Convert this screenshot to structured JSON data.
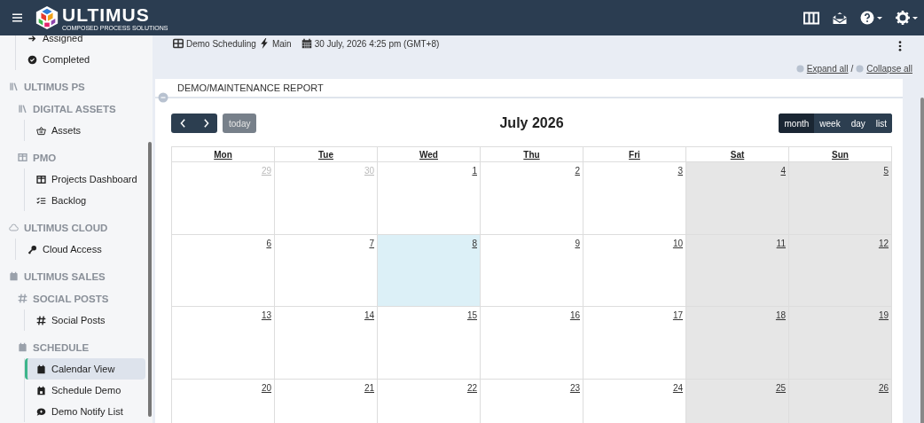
{
  "header": {
    "logo_name": "ULTIMUS",
    "logo_tagline": "COMPOSED PROCESS SOLUTIONS"
  },
  "sidebar": {
    "items": [
      {
        "kind": "link",
        "label": "Assigned",
        "selected": false
      },
      {
        "kind": "link",
        "label": "Completed",
        "selected": false
      },
      {
        "kind": "section",
        "label": "ULTIMUS PS",
        "children": [
          {
            "kind": "subsection",
            "label": "DIGITAL ASSETS",
            "children": [
              {
                "kind": "link",
                "label": "Assets",
                "selected": false
              }
            ]
          },
          {
            "kind": "subsection",
            "label": "PMO",
            "children": [
              {
                "kind": "link",
                "label": "Projects Dashboard",
                "selected": false
              },
              {
                "kind": "link",
                "label": "Backlog",
                "selected": false
              }
            ]
          }
        ]
      },
      {
        "kind": "section",
        "label": "ULTIMUS CLOUD",
        "children": [
          {
            "kind": "link",
            "label": "Cloud Access",
            "selected": false
          }
        ]
      },
      {
        "kind": "section",
        "label": "ULTIMUS SALES",
        "children": [
          {
            "kind": "subsection",
            "label": "SOCIAL POSTS",
            "children": [
              {
                "kind": "link",
                "label": "Social Posts",
                "selected": false
              }
            ]
          },
          {
            "kind": "subsection",
            "label": "SCHEDULE",
            "children": [
              {
                "kind": "link",
                "label": "Calendar View",
                "selected": true
              },
              {
                "kind": "link",
                "label": "Schedule Demo",
                "selected": false
              },
              {
                "kind": "link",
                "label": "Demo Notify List",
                "selected": false
              }
            ]
          }
        ]
      }
    ]
  },
  "breadcrumb": {
    "app": "Demo Scheduling",
    "branch": "Main",
    "datetime": "30 July, 2026 4:25 pm (GMT+8)"
  },
  "expand_all": "Expand all",
  "separator": "/",
  "collapse_all": "Collapse all",
  "card": {
    "title": "DEMO/MAINTENANCE REPORT"
  },
  "calendar": {
    "today_button": {
      "label": "today",
      "disabled": true
    },
    "title": "July 2026",
    "views": [
      {
        "label": "month",
        "selected": true
      },
      {
        "label": "week",
        "selected": false
      },
      {
        "label": "day",
        "selected": false
      },
      {
        "label": "list",
        "selected": false
      }
    ],
    "columns": [
      "Mon",
      "Tue",
      "Wed",
      "Thu",
      "Fri",
      "Sat",
      "Sun"
    ],
    "weeks": [
      [
        {
          "day": "29",
          "other_month": true,
          "today": false,
          "weekend": false
        },
        {
          "day": "30",
          "other_month": true,
          "today": false,
          "weekend": false
        },
        {
          "day": "1",
          "other_month": false,
          "today": false,
          "weekend": false
        },
        {
          "day": "2",
          "other_month": false,
          "today": false,
          "weekend": false
        },
        {
          "day": "3",
          "other_month": false,
          "today": false,
          "weekend": false
        },
        {
          "day": "4",
          "other_month": false,
          "today": false,
          "weekend": true
        },
        {
          "day": "5",
          "other_month": false,
          "today": false,
          "weekend": true
        }
      ],
      [
        {
          "day": "6",
          "other_month": false,
          "today": false,
          "weekend": false
        },
        {
          "day": "7",
          "other_month": false,
          "today": false,
          "weekend": false
        },
        {
          "day": "8",
          "other_month": false,
          "today": true,
          "weekend": false
        },
        {
          "day": "9",
          "other_month": false,
          "today": false,
          "weekend": false
        },
        {
          "day": "10",
          "other_month": false,
          "today": false,
          "weekend": false
        },
        {
          "day": "11",
          "other_month": false,
          "today": false,
          "weekend": true
        },
        {
          "day": "12",
          "other_month": false,
          "today": false,
          "weekend": true
        }
      ],
      [
        {
          "day": "13",
          "other_month": false,
          "today": false,
          "weekend": false
        },
        {
          "day": "14",
          "other_month": false,
          "today": false,
          "weekend": false
        },
        {
          "day": "15",
          "other_month": false,
          "today": false,
          "weekend": false
        },
        {
          "day": "16",
          "other_month": false,
          "today": false,
          "weekend": false
        },
        {
          "day": "17",
          "other_month": false,
          "today": false,
          "weekend": false
        },
        {
          "day": "18",
          "other_month": false,
          "today": false,
          "weekend": true
        },
        {
          "day": "19",
          "other_month": false,
          "today": false,
          "weekend": true
        }
      ],
      [
        {
          "day": "20",
          "other_month": false,
          "today": false,
          "weekend": false
        },
        {
          "day": "21",
          "other_month": false,
          "today": false,
          "weekend": false
        },
        {
          "day": "22",
          "other_month": false,
          "today": false,
          "weekend": false
        },
        {
          "day": "23",
          "other_month": false,
          "today": false,
          "weekend": false
        },
        {
          "day": "24",
          "other_month": false,
          "today": false,
          "weekend": false
        },
        {
          "day": "25",
          "other_month": false,
          "today": false,
          "weekend": true
        },
        {
          "day": "26",
          "other_month": false,
          "today": false,
          "weekend": true
        }
      ]
    ]
  }
}
